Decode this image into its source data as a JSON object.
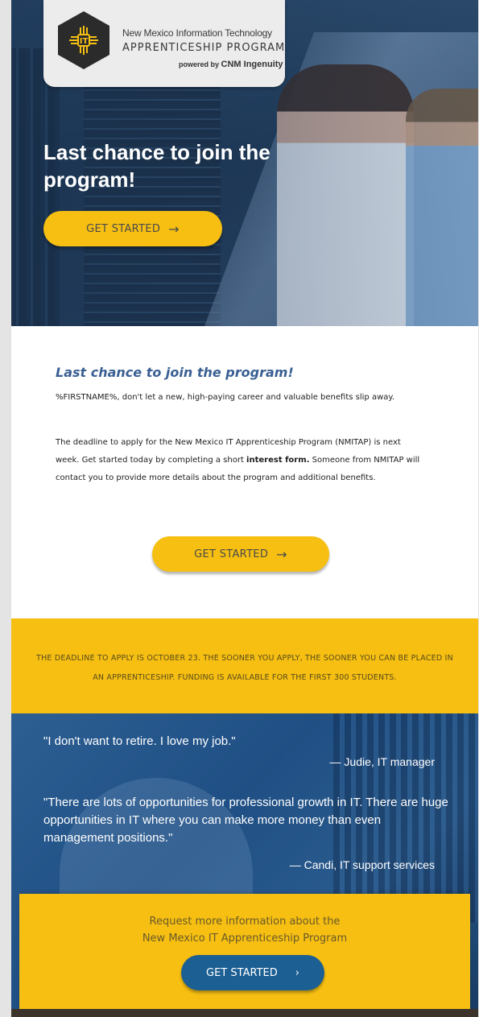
{
  "logo": {
    "line1": "New Mexico Information Technology",
    "line2": "APPRENTICESHIP PROGRAM",
    "line3_prefix": "powered by",
    "line3_brand": "CNM Ingenuity"
  },
  "hero": {
    "title": "Last chance to join the program!",
    "button_label": "GET STARTED",
    "button_icon": "arrow-right-icon"
  },
  "content": {
    "heading": "Last chance to join the program!",
    "para1": "%FIRSTNAME%, don't let a new, high-paying career and valuable benefits slip away.",
    "para2_before": "The deadline to apply for the New Mexico IT Apprenticeship Program (NMITAP) is next week. Get started today by completing a short ",
    "para2_bold": "interest form.",
    "para2_after": " Someone from NMITAP will contact you to provide more details about the program and additional benefits.",
    "button_label": "GET STARTED"
  },
  "deadline": {
    "text": "THE DEADLINE TO APPLY IS OCTOBER 23. THE SOONER YOU APPLY, THE SOONER YOU CAN BE PLACED IN AN APPRENTICESHIP. FUNDING IS AVAILABLE FOR THE FIRST 300 STUDENTS."
  },
  "quotes": [
    {
      "text": "\"I don't want to retire. I love my job.\"",
      "attribution": "— Judie, IT manager"
    },
    {
      "text": "\"There are lots of opportunities for professional growth in IT. There are huge opportunities in IT where you can make more money than even management positions.\"",
      "attribution": "— Candi, IT support services"
    }
  ],
  "cta": {
    "line1": "Request more information about the",
    "line2": "New Mexico IT Apprenticeship Program",
    "button_label": "GET STARTED",
    "button_icon": "chevron-right-icon"
  },
  "colors": {
    "accent_yellow": "#f6bf12",
    "heading_blue": "#3a5f93",
    "button_blue": "#1c5f93"
  }
}
